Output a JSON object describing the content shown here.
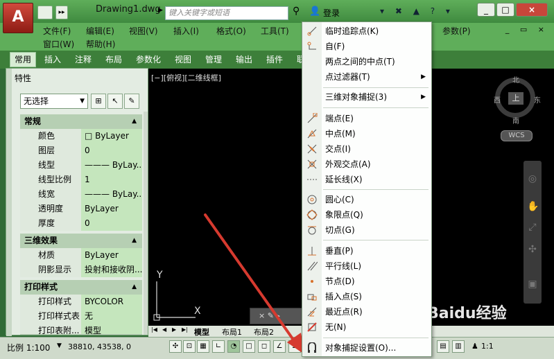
{
  "app": {
    "logo_letter": "A",
    "document_title": "Drawing1.dwg",
    "search_placeholder": "键入关键字或短语",
    "login_label": "登录"
  },
  "menubar": {
    "items": [
      "文件(F)",
      "编辑(E)",
      "视图(V)",
      "插入(I)",
      "格式(O)",
      "工具(T)",
      "参数(P)",
      "窗口(W)",
      "帮助(H)"
    ]
  },
  "ribbon": {
    "tabs": [
      "常用",
      "插入",
      "注释",
      "布局",
      "参数化",
      "视图",
      "管理",
      "输出",
      "插件",
      "联"
    ]
  },
  "properties": {
    "title": "特性",
    "selection": "无选择",
    "sections": [
      {
        "name": "常规",
        "rows": [
          {
            "key": "颜色",
            "value": "□ ByLayer"
          },
          {
            "key": "图层",
            "value": "0"
          },
          {
            "key": "线型",
            "value": "——— ByLay..."
          },
          {
            "key": "线型比例",
            "value": "1"
          },
          {
            "key": "线宽",
            "value": "——— ByLay..."
          },
          {
            "key": "透明度",
            "value": "ByLayer"
          },
          {
            "key": "厚度",
            "value": "0"
          }
        ]
      },
      {
        "name": "三维效果",
        "rows": [
          {
            "key": "材质",
            "value": "ByLayer"
          },
          {
            "key": "阴影显示",
            "value": "投射和接收阴..."
          }
        ]
      },
      {
        "name": "打印样式",
        "rows": [
          {
            "key": "打印样式",
            "value": "BYCOLOR"
          },
          {
            "key": "打印样式表",
            "value": "无"
          },
          {
            "key": "打印表附...",
            "value": "模型"
          }
        ]
      }
    ]
  },
  "viewport": {
    "label": "[−][俯视][二维线框]",
    "viewcube": {
      "top": "上",
      "north": "北",
      "south": "南",
      "east": "东",
      "west": "西",
      "wcs": "WCS"
    },
    "axis_y": "Y",
    "axis_x": "X"
  },
  "layout_tabs": [
    "模型",
    "布局1",
    "布局2"
  ],
  "statusbar": {
    "scale": "比例 1:100",
    "coords": "38810, 43538, 0",
    "scale_right": "1:1"
  },
  "context_menu": {
    "items": [
      {
        "label": "临时追踪点(K)",
        "icon": "temp-track-icon",
        "submenu": false
      },
      {
        "label": "自(F)",
        "icon": "from-icon",
        "submenu": false
      },
      {
        "label": "两点之间的中点(T)",
        "icon": "",
        "submenu": false
      },
      {
        "label": "点过滤器(T)",
        "icon": "",
        "submenu": true
      },
      {
        "label": "三维对象捕捉(3)",
        "icon": "",
        "submenu": true
      },
      {
        "label": "端点(E)",
        "icon": "endpoint-icon",
        "submenu": false
      },
      {
        "label": "中点(M)",
        "icon": "midpoint-icon",
        "submenu": false
      },
      {
        "label": "交点(I)",
        "icon": "intersection-icon",
        "submenu": false
      },
      {
        "label": "外观交点(A)",
        "icon": "apparent-intersection-icon",
        "submenu": false
      },
      {
        "label": "延长线(X)",
        "icon": "extension-icon",
        "submenu": false
      },
      {
        "label": "圆心(C)",
        "icon": "center-icon",
        "submenu": false
      },
      {
        "label": "象限点(Q)",
        "icon": "quadrant-icon",
        "submenu": false
      },
      {
        "label": "切点(G)",
        "icon": "tangent-icon",
        "submenu": false
      },
      {
        "label": "垂直(P)",
        "icon": "perpendicular-icon",
        "submenu": false
      },
      {
        "label": "平行线(L)",
        "icon": "parallel-icon",
        "submenu": false
      },
      {
        "label": "节点(D)",
        "icon": "node-icon",
        "submenu": false
      },
      {
        "label": "插入点(S)",
        "icon": "insert-icon",
        "submenu": false
      },
      {
        "label": "最近点(R)",
        "icon": "nearest-icon",
        "submenu": false
      },
      {
        "label": "无(N)",
        "icon": "none-icon",
        "submenu": false
      },
      {
        "label": "对象捕捉设置(O)...",
        "icon": "osnap-settings-icon",
        "submenu": false
      }
    ]
  },
  "watermark": "Baidu经验",
  "colors": {
    "accent_red": "#d63a2f",
    "title_green": "#5fae5a"
  }
}
